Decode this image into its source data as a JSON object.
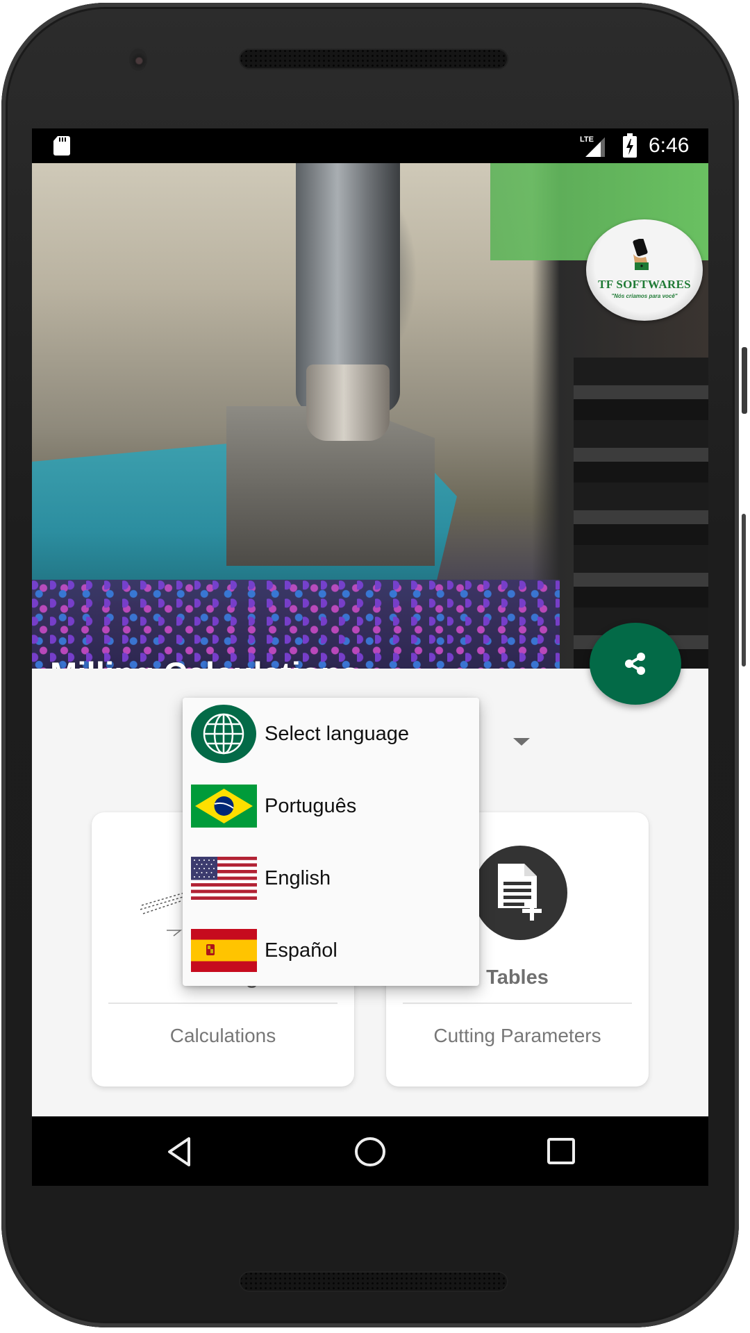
{
  "status_bar": {
    "time": "6:46",
    "network": "LTE",
    "icons": [
      "sd-card-icon",
      "lte-signal-icon",
      "battery-charging-icon"
    ]
  },
  "hero": {
    "title": "Milling Calculations",
    "logo": {
      "name": "TF SOFTWARES",
      "tagline": "\"Nós criamos para você\""
    }
  },
  "share_button": {
    "icon": "share-icon",
    "color": "#036a47"
  },
  "language_menu": {
    "header": {
      "label": "Select language",
      "icon": "globe-icon"
    },
    "options": [
      {
        "label": "Português",
        "icon": "brazil-flag-icon"
      },
      {
        "label": "English",
        "icon": "usa-flag-icon"
      },
      {
        "label": "Español",
        "icon": "spain-flag-icon"
      }
    ]
  },
  "cards": [
    {
      "title": "Cutting",
      "subtitle": "Calculations",
      "icon": "cutting-sketch-icon"
    },
    {
      "title": "Tables",
      "subtitle": "Cutting Parameters",
      "icon": "document-add-icon"
    }
  ],
  "nav_bar": {
    "buttons": [
      "back-icon",
      "home-icon",
      "recents-icon"
    ]
  },
  "colors": {
    "accent": "#036a47",
    "logo_green": "#1f7a35",
    "card_title": "#6f6f6f"
  }
}
